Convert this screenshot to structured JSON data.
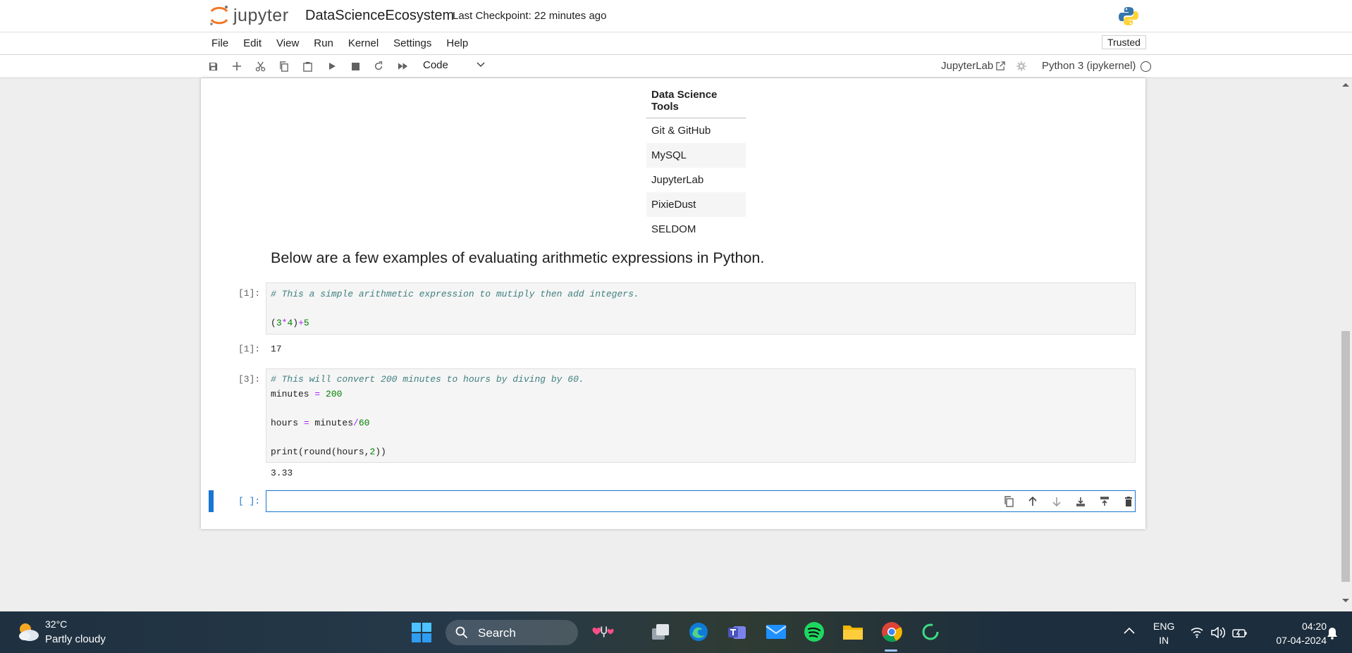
{
  "header": {
    "logo_text": "jupyter",
    "notebook_title": "DataScienceEcosystem",
    "checkpoint": "Last Checkpoint: 22 minutes ago"
  },
  "menu": {
    "items": [
      "File",
      "Edit",
      "View",
      "Run",
      "Kernel",
      "Settings",
      "Help"
    ],
    "trusted": "Trusted"
  },
  "toolbar": {
    "cell_type": "Code",
    "jupyterlab_link": "JupyterLab",
    "kernel": "Python 3 (ipykernel)"
  },
  "table": {
    "header": "Data Science Tools",
    "rows": [
      "Git & GitHub",
      "MySQL",
      "JupyterLab",
      "PixieDust",
      "SELDOM"
    ]
  },
  "markdown": {
    "heading": "Below are a few examples of evaluating arithmetic expressions in Python."
  },
  "cells": [
    {
      "in_prompt": "[1]:",
      "comment": "# This a simple arithmetic expression to mutiply then add integers.",
      "out_prompt": "[1]:",
      "output": "17"
    },
    {
      "in_prompt": "[3]:",
      "comment": "# This will convert 200 minutes to hours by diving by 60.",
      "output": "3.33"
    },
    {
      "in_prompt": "[ ]:"
    }
  ],
  "taskbar": {
    "temperature": "32°C",
    "condition": "Partly cloudy",
    "search": "Search",
    "lang_top": "ENG",
    "lang_bottom": "IN",
    "time": "04:20",
    "date": "07-04-2024"
  }
}
